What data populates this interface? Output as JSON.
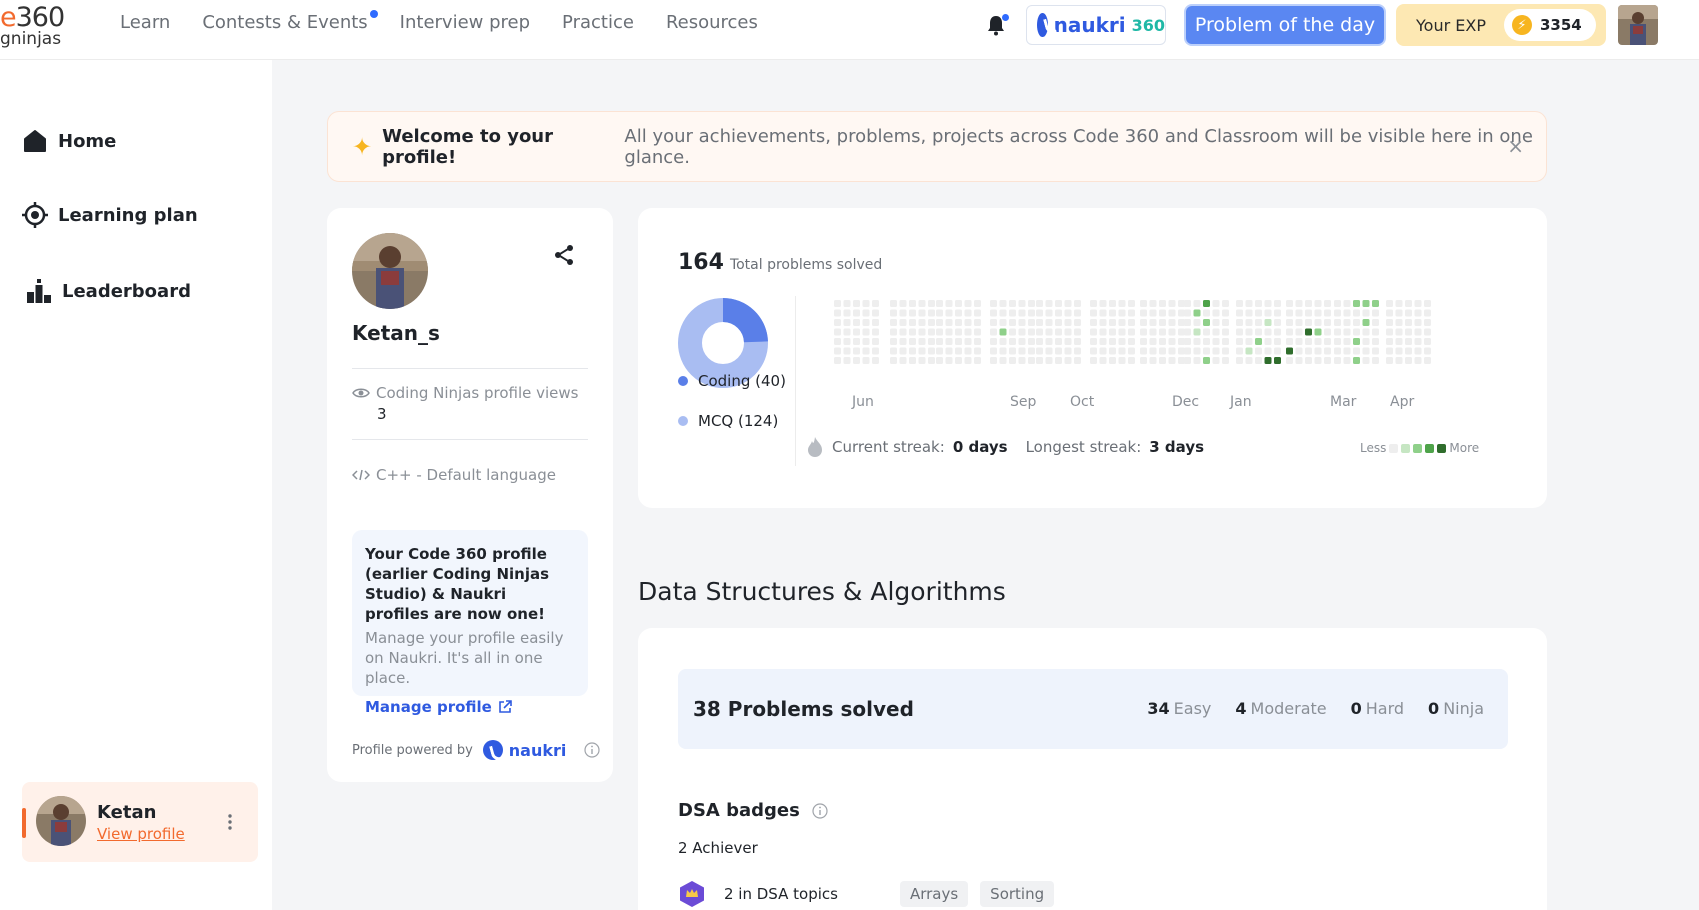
{
  "brand": {
    "num": "360",
    "letter": "e",
    "sub": "gninjas"
  },
  "nav": {
    "links": [
      "Learn",
      "Contests & Events",
      "Interview prep",
      "Practice",
      "Resources"
    ],
    "naukri_label": "naukri",
    "naukri_suffix": "360",
    "potd_label": "Problem of the day",
    "exp_label": "Your EXP",
    "exp_value": "3354",
    "bolt": "⚡"
  },
  "sidebar": {
    "items": [
      {
        "label": "Home",
        "icon": "home-icon"
      },
      {
        "label": "Learning plan",
        "icon": "target-icon"
      },
      {
        "label": "Leaderboard",
        "icon": "leaderboard-icon"
      }
    ],
    "user": {
      "name": "Ketan",
      "link": "View profile"
    }
  },
  "welcome": {
    "star": "✦",
    "title": "Welcome to your profile!",
    "desc": "All your achievements, problems, projects across Code 360 and Classroom will be visible here in one glance.",
    "close": "×"
  },
  "profile": {
    "username": "Ketan_s",
    "views_label": "Coding Ninjas profile views",
    "views_value": "3",
    "language": "C++ - Default language",
    "notice_title": "Your Code 360 profile (earlier Coding Ninjas Studio) & Naukri profiles are now one!",
    "notice_desc": "Manage your profile easily on Naukri. It's all in one place.",
    "notice_link": "Manage profile",
    "powered_label": "Profile powered by",
    "powered_brand": "naukri"
  },
  "stats": {
    "total_value": "164",
    "total_label": "Total problems solved",
    "legend": [
      {
        "label": "Coding (40)",
        "color": "#5a7fe8"
      },
      {
        "label": "MCQ (124)",
        "color": "#a9bdf2"
      }
    ],
    "coding": 40,
    "mcq": 124,
    "months": [
      "Jun",
      "Sep",
      "Oct",
      "Dec",
      "Jan",
      "Mar",
      "Apr"
    ],
    "current_streak_label": "Current streak:",
    "current_streak_value": "0 days",
    "longest_streak_label": "Longest streak:",
    "longest_streak_value": "3 days",
    "less": "Less",
    "more": "More",
    "scale_colors": [
      "#eeeeee",
      "#c6e6c3",
      "#8fd08a",
      "#4ea34a",
      "#2f6d2c"
    ]
  },
  "dsa": {
    "title": "Data Structures & Algorithms",
    "solved": "38 Problems solved",
    "difficulties": [
      {
        "value": "34",
        "label": "Easy"
      },
      {
        "value": "4",
        "label": "Moderate"
      },
      {
        "value": "0",
        "label": "Hard"
      },
      {
        "value": "0",
        "label": "Ninja"
      }
    ],
    "badges_title": "DSA badges",
    "achiever": "2 Achiever",
    "topics_text": "2 in DSA topics",
    "topics": [
      "Arrays",
      "Sorting"
    ]
  }
}
